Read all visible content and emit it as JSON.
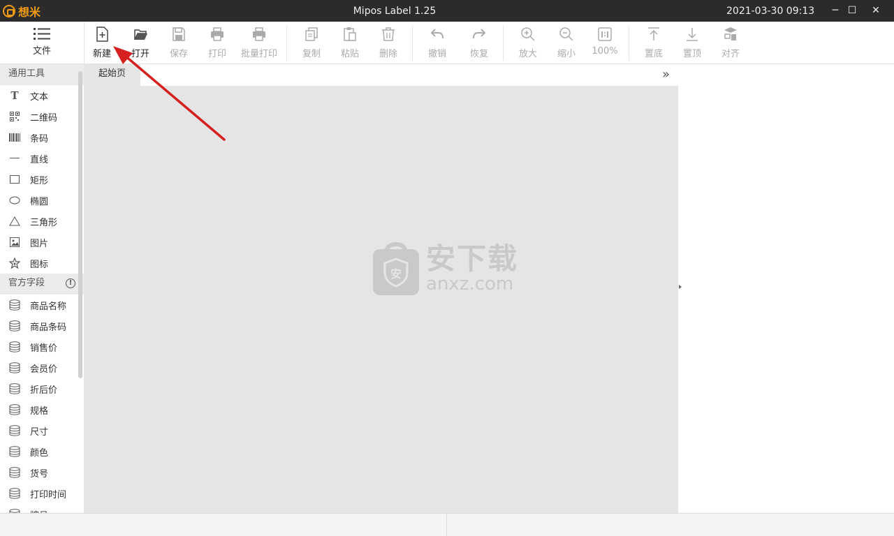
{
  "titlebar": {
    "logo_text": "想米",
    "app_title": "Mipos Label 1.25",
    "datetime": "2021-03-30 09:13",
    "minimize": "─",
    "maximize": "☐",
    "close": "✕"
  },
  "toolbar": {
    "file": "文件",
    "new": "新建",
    "open": "打开",
    "save": "保存",
    "print": "打印",
    "batch_print": "批量打印",
    "copy": "复制",
    "paste": "粘贴",
    "delete": "删除",
    "undo": "撤销",
    "redo": "恢复",
    "zoom_in": "放大",
    "zoom_out": "缩小",
    "zoom_level": "100%",
    "send_back": "置底",
    "bring_front": "置顶",
    "align": "对齐"
  },
  "sidebar": {
    "general_tools": "通用工具",
    "tools": [
      {
        "label": "文本",
        "icon": "text-icon"
      },
      {
        "label": "二维码",
        "icon": "qrcode-icon"
      },
      {
        "label": "条码",
        "icon": "barcode-icon"
      },
      {
        "label": "直线",
        "icon": "line-icon"
      },
      {
        "label": "矩形",
        "icon": "rectangle-icon"
      },
      {
        "label": "椭圆",
        "icon": "ellipse-icon"
      },
      {
        "label": "三角形",
        "icon": "triangle-icon"
      },
      {
        "label": "图片",
        "icon": "image-icon"
      },
      {
        "label": "图标",
        "icon": "star-icon"
      }
    ],
    "official_fields": "官方字段",
    "info_glyph": "!",
    "fields": [
      {
        "label": "商品名称"
      },
      {
        "label": "商品条码"
      },
      {
        "label": "销售价"
      },
      {
        "label": "会员价"
      },
      {
        "label": "折后价"
      },
      {
        "label": "规格"
      },
      {
        "label": "尺寸"
      },
      {
        "label": "颜色"
      },
      {
        "label": "货号"
      },
      {
        "label": "打印时间"
      },
      {
        "label": "牌号"
      }
    ]
  },
  "workspace": {
    "tab_start": "起始页",
    "expand": "»",
    "watermark_cn": "安下载",
    "watermark_en": "anxz.com"
  },
  "colors": {
    "titlebar_bg": "#2b2b2b",
    "logo": "#f39c12",
    "canvas_bg": "#e5e5e5",
    "annotation_arrow": "#d62020"
  }
}
